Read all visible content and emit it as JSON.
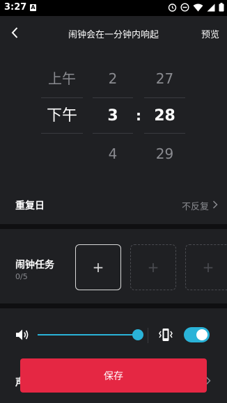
{
  "status_bar": {
    "time": "3:27",
    "notification_letter": "A",
    "icons": [
      "alarm-icon",
      "do-not-disturb-icon",
      "wifi-icon",
      "cellular-icon",
      "battery-icon"
    ]
  },
  "header": {
    "title": "闹钟会在一分钟内响起",
    "preview_label": "预览"
  },
  "time_picker": {
    "ampm": [
      "上午",
      "下午",
      ""
    ],
    "hours": [
      "2",
      "3",
      "4"
    ],
    "minutes": [
      "27",
      "28",
      "29"
    ],
    "separator": ":"
  },
  "repeat": {
    "label": "重复日",
    "value": "不反复"
  },
  "tasks": {
    "label": "闹钟任务",
    "count": "0/5",
    "add_symbol": "+"
  },
  "volume": {
    "level": 1.0,
    "vibrate_enabled": true
  },
  "sound": {
    "label": "声"
  },
  "save_label": "保存",
  "colors": {
    "accent": "#2ab3d8",
    "save_button": "#e52743",
    "background": "#1f2023"
  }
}
